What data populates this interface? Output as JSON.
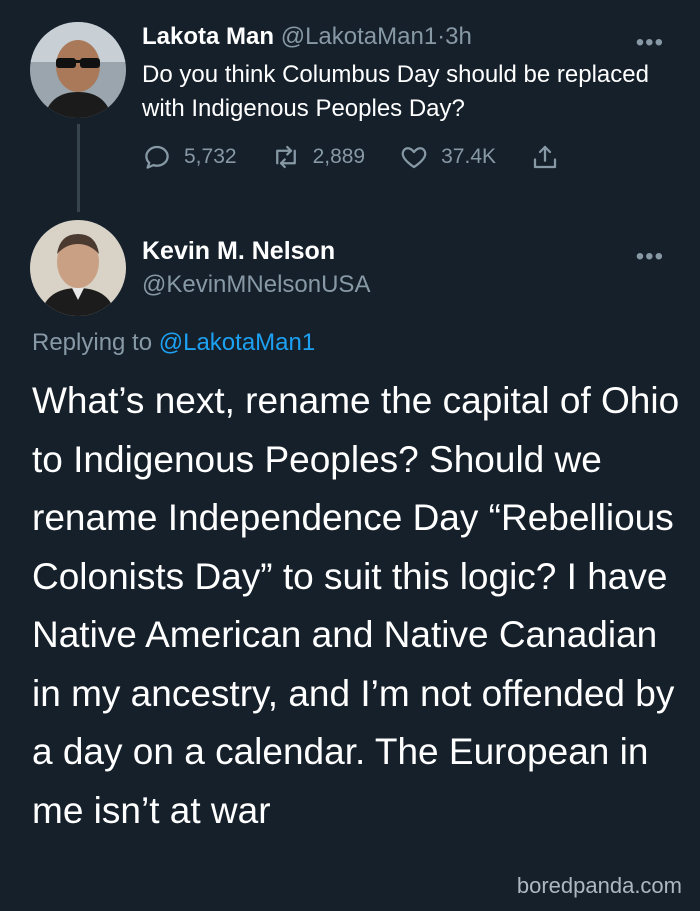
{
  "tweet1": {
    "display_name": "Lakota Man",
    "handle": "@LakotaMan1",
    "separator": "·",
    "time": "3h",
    "text": "Do you think Columbus Day should be replaced with Indigenous Peoples Day?",
    "replies": "5,732",
    "retweets": "2,889",
    "likes": "37.4K",
    "more": "•••"
  },
  "tweet2": {
    "display_name": "Kevin M. Nelson",
    "handle": "@KevinMNelsonUSA",
    "more": "•••",
    "replying_prefix": "Replying to",
    "replying_to": "@LakotaMan1",
    "body": "What’s next, rename the capital of Ohio to Indigenous Peoples? Should we rename Independence Day “Rebellious Colonists Day” to suit this logic? I have Native American and Native Canadian in my ancestry, and I’m not offended by a day on a calendar. The European in me isn’t at war"
  },
  "watermark": "boredpanda.com",
  "colors": {
    "background": "#15202b",
    "muted": "#8899a6",
    "link": "#1da1f2",
    "text": "#ffffff"
  }
}
